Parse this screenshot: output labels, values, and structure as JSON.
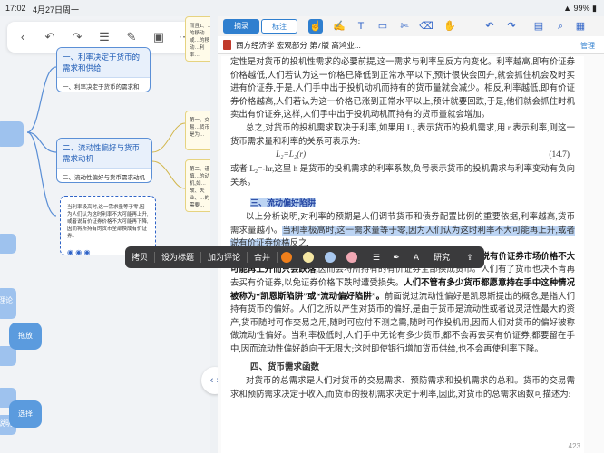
{
  "status": {
    "time": "17:02",
    "date": "4月27日周一",
    "battery": "99%"
  },
  "toolbar_icons": [
    "back-icon",
    "undo-icon",
    "redo-icon",
    "list-icon",
    "edit-icon",
    "image-icon",
    "more-icon"
  ],
  "mindmap": {
    "node1": {
      "title": "一、利率决定于货币的需求和供给",
      "sub": "一、利率决定于货币的需求和供给"
    },
    "node2": {
      "title": "二、流动性偏好与货币需求动机",
      "sub": "二、流动性偏好与货币需求动机"
    },
    "note_top": "而且1、…的移动或…的移动…利率…",
    "note_a": "第一、交易…货币是为…",
    "note_b": "第二、谨慎…的动机,如…故、失业、…的需要…",
    "dashed": "当利率极高时,这一需求量等于零,因为人们认为这时利率不大可能再上升,或者说有价证券价格不大可能再下降,因而将所持有的货币全部换成有价证券。",
    "side_label_a": "理论",
    "side_label_b": "说明",
    "button_pan": "拖放",
    "button_select": "选择"
  },
  "reader": {
    "tab_excerpt": "摘录",
    "tab_note": "标注",
    "book_title": "西方经济学 宏观部分 第7版 高鸿业...",
    "manage": "管理",
    "para1": "定性是对货币的投机性需求的必要前提,这一需求与利率呈反方向变化。利率越高,即有价证券价格越低,人们若认为这一价格已降低到正常水平以下,预计很快会回升,就会抓住机会及时买进有价证券,于是,人们手中出于投机动机而持有的货币量就会减少。相反,利率越低,即有价证券价格越高,人们若认为这一价格已涨到正常水平以上,预计就要回跌,于是,他们就会抓住时机卖出有价证券,这样,人们手中出于投机动机而持有的货币量就会增加。",
    "para2": "总之,对货币的投机需求取决于利率,如果用 L₂ 表示货币的投机需求,用 r 表示利率,则这一货币需求量和利率的关系可表示为:",
    "eq1": "L₂=L₂(r)",
    "eq1_num": "(14.7)",
    "para3": "或者 L₂=-hr,这里 h 是货币的投机需求的利率系数,负号表示货币的投机需求与利率变动有负向关系。",
    "section": "三、流动偏好陷阱",
    "para4a": "以上分析说明,对利率的预期是人们调节货币和债券配置比例的重要依据,利率越高,货币需求量越小。",
    "para4b": "当利率极高时,这一需求量等于零,因为人们认为这时利率不大可能再上升,或者说有价证券价格",
    "para4c": "反之,",
    "para5_bold": "当利率极低时,比方说 2%,人们会认为这时利率不大可能再下降,或者说有价证券市场价格不大可能再上升而只会跌落,",
    "para5_rest": "因而会将所持有的有价证券全部换成货币。人们有了货币也决不肯再去买有价证券,以免证券价格下跌时遭受损失。",
    "para5_bold2": "人们不管有多少货币都愿意持在手中这种情况被称为“凯恩斯陷阱”或“流动偏好陷阱”。",
    "para5_end": "前面说过流动性偏好是凯恩斯提出的概念,是指人们持有货币的偏好。人们之所以产生对货币的偏好,是由于货币是流动性或者说灵活性最大的资产,货币随时可作交易之用,随时可应付不测之需,随时可作投机用,因而人们对货币的偏好被称做流动性偏好。当利率极低时,人们手中无论有多少货币,都不会再去买有价证券,都要留在手中,因而流动性偏好趋向于无限大;这时即使银行增加货币供给,也不会再使利率下降。",
    "section4": "四、货币需求函数",
    "para6": "对货币的总需求是人们对货币的交易需求、预防需求和投机需求的总和。货币的交易需求和预防需求决定于收入,而货币的投机需求决定于利率,因此,对货币的总需求函数可描述为:",
    "page_num": "423"
  },
  "context_menu": {
    "copy": "拷贝",
    "heading": "设为标题",
    "comment": "加为评论",
    "merge": "合并",
    "research": "研究",
    "colors": [
      "#f07f1b",
      "#f5e7a3",
      "#a9c8ef",
      "#f1a8b4"
    ]
  },
  "colors": {
    "accent": "#2f7fcf",
    "node_border": "#5b8fd6",
    "highlight": "#bcd4f3"
  }
}
